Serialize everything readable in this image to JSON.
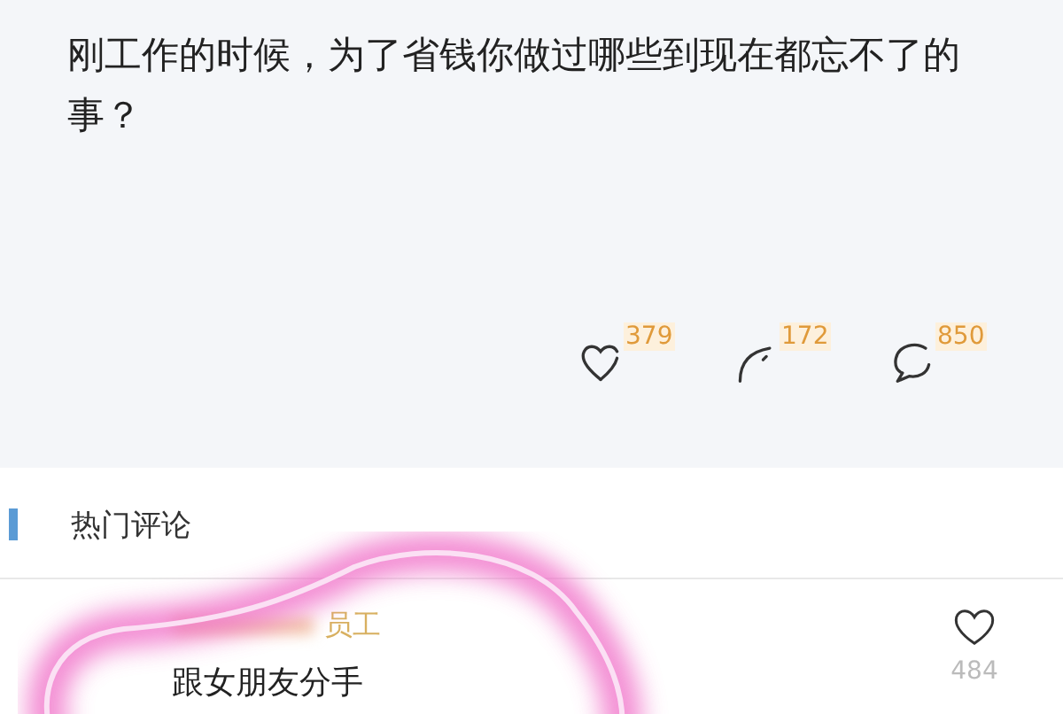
{
  "post": {
    "question": "刚工作的时候，为了省钱你做过哪些到现在都忘不了的事？",
    "stats": [
      {
        "kind": "like",
        "count": "379"
      },
      {
        "kind": "repost",
        "count": "172"
      },
      {
        "kind": "comment",
        "count": "850"
      }
    ]
  },
  "hot_comments": {
    "heading": "热门评论",
    "comments": [
      {
        "author": "员工",
        "text": "跟女朋友分手",
        "likes": "484"
      }
    ]
  }
}
